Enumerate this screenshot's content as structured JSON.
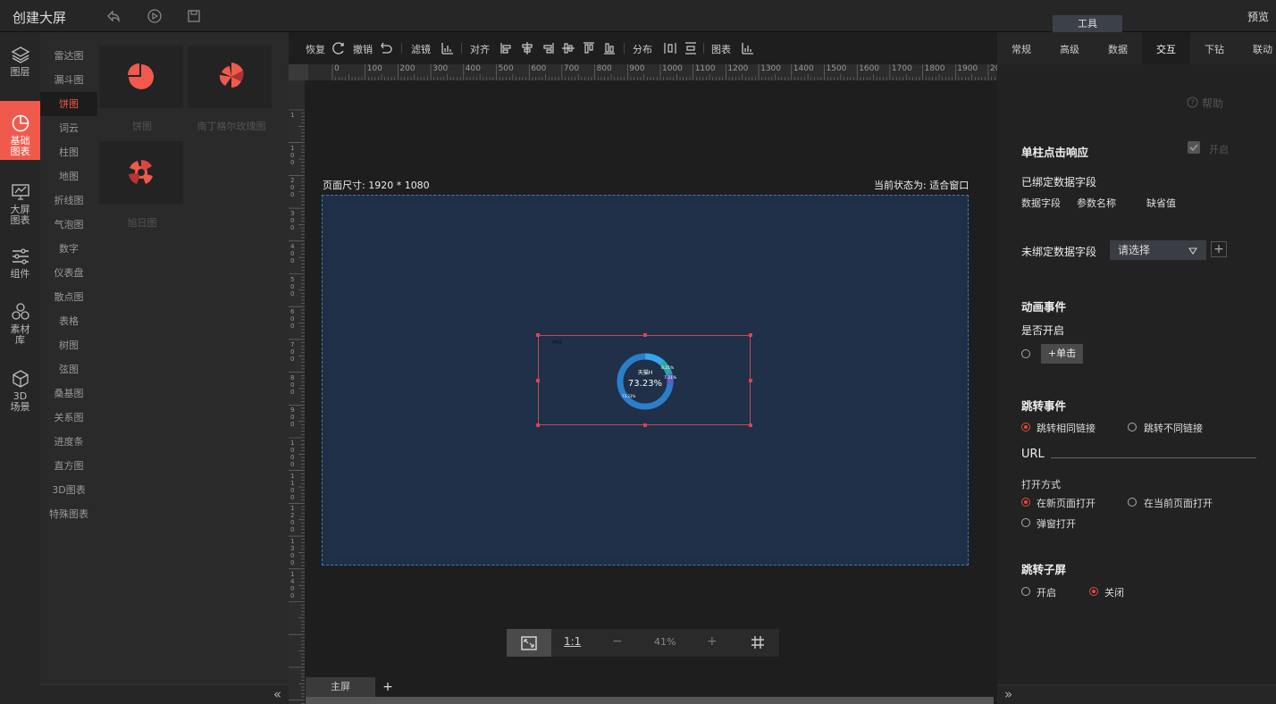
{
  "app": {
    "title": "创建大屏",
    "preview": "预览",
    "tool_tab": "工具"
  },
  "left_nav": [
    {
      "label1": "图层",
      "label2": "",
      "icon": "layers-icon"
    },
    {
      "label1": "基础",
      "label2": "图表",
      "icon": "pie-chart-icon",
      "active": true
    },
    {
      "label1": "大屏",
      "label2": "图表",
      "icon": "monitor-chart-icon"
    },
    {
      "label1": "组件",
      "label2": "",
      "icon": "sliders-icon"
    },
    {
      "label1": "素材",
      "label2": "库",
      "icon": "hexagons-icon"
    },
    {
      "label1": "3D",
      "label2": "场景",
      "icon": "cube-icon"
    }
  ],
  "categories": [
    "雷达图",
    "漏斗图",
    "饼图",
    "词云",
    "柱图",
    "地图",
    "折线图",
    "气泡图",
    "数字",
    "仪表盘",
    "散点图",
    "表格",
    "树图",
    "弦图",
    "桑基图",
    "关系图",
    "进度条",
    "直方图",
    "3D图表",
    "特殊图表"
  ],
  "active_category": "饼图",
  "thumbnails": [
    {
      "label": "饼图",
      "icon": "pie-icon"
    },
    {
      "label": "南丁格尔玫瑰图",
      "icon": "rose-chart-icon"
    },
    {
      "label": "旭日图",
      "icon": "sunburst-icon"
    }
  ],
  "toolbar": {
    "redo": "恢复",
    "undo": "撤销",
    "filter": "滤镜",
    "align": "对齐",
    "distribute": "分布",
    "chart": "图表"
  },
  "ruler": {
    "h_labels": [
      "0",
      "100",
      "200",
      "300",
      "400",
      "500",
      "600",
      "700",
      "800",
      "900",
      "1000",
      "1100",
      "1200",
      "1300",
      "1400",
      "1500",
      "1600",
      "1700",
      "1800",
      "1900",
      "20"
    ],
    "v_labels": [
      "1",
      "1\n0\n0",
      "2\n0\n0",
      "3\n0\n0",
      "4\n0\n0",
      "5\n0\n0",
      "6\n0\n0",
      "7\n0\n0",
      "8\n0\n0",
      "9\n0\n0",
      "1\n0\n0\n0",
      "1\n1\n0\n0",
      "1\n2\n0\n0",
      "1\n3\n0\n0",
      "1\n4\n0\n0"
    ]
  },
  "canvas": {
    "page_size": "页面尺寸: 1920 * 1080",
    "fit_status": "当前状态为: 适合窗口",
    "chart_center_title": "天猫H",
    "chart_center_value": "73.23%",
    "slice_labels": [
      "8.21%",
      "7.31%",
      "73.23%"
    ],
    "corner_tag": "PM2"
  },
  "zoom": {
    "ratio": "1:1",
    "minus": "−",
    "value": "41%",
    "plus": "+"
  },
  "screens": {
    "main": "主屏",
    "add": "+"
  },
  "right_panel": {
    "tabs": [
      "常规",
      "高级",
      "数据",
      "交互",
      "下钻",
      "联动"
    ],
    "active_tab": "交互",
    "help": "帮助",
    "single_click": "单柱点击响应",
    "enable": "开启",
    "bound_fields": "已绑定数据字段",
    "col_field": "数据字段",
    "col_param": "参数名称",
    "col_default": "缺省值",
    "unbound_fields": "未绑定数据字段",
    "select_placeholder": "请选择",
    "anim_event": "动画事件",
    "is_enabled": "是否开启",
    "click_btn": "+单击",
    "jump_event": "跳转事件",
    "same_link": "跳转相同链接",
    "diff_link": "跳转不同链接",
    "url": "URL",
    "open_mode": "打开方式",
    "new_page": "在新页面打开",
    "current_page": "在当前页面打开",
    "popup": "弹窗打开",
    "jump_sub": "跳转子屏",
    "sub_on": "开启",
    "sub_off": "关闭"
  },
  "colors": {
    "accent": "#f05a4c",
    "chart_blue": "#2a7fc8",
    "canvas_bg": "#1f3048"
  }
}
